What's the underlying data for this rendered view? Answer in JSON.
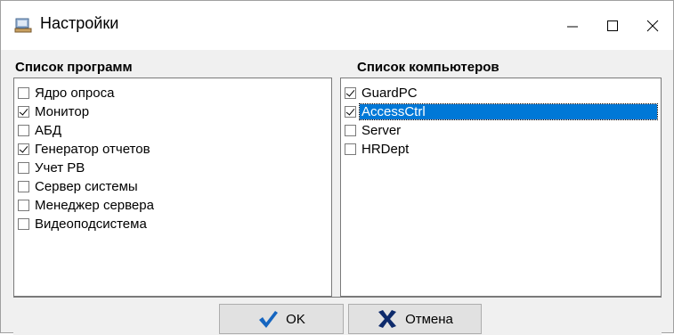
{
  "window": {
    "title": "Настройки",
    "icon": "settings-app-icon"
  },
  "programs": {
    "title": "Список программ",
    "items": [
      {
        "label": "Ядро опроса",
        "checked": false
      },
      {
        "label": "Монитор",
        "checked": true
      },
      {
        "label": "АБД",
        "checked": false
      },
      {
        "label": "Генератор отчетов",
        "checked": true
      },
      {
        "label": "Учет РВ",
        "checked": false
      },
      {
        "label": "Сервер системы",
        "checked": false
      },
      {
        "label": "Менеджер сервера",
        "checked": false
      },
      {
        "label": "Видеоподсистема",
        "checked": false
      }
    ]
  },
  "computers": {
    "title": "Список компьютеров",
    "items": [
      {
        "label": "GuardPC",
        "checked": true,
        "selected": false
      },
      {
        "label": "AccessCtrl",
        "checked": true,
        "selected": true
      },
      {
        "label": "Server",
        "checked": false,
        "selected": false
      },
      {
        "label": "HRDept",
        "checked": false,
        "selected": false
      }
    ]
  },
  "buttons": {
    "ok_label": "OK",
    "cancel_label": "Отмена",
    "ok_icon": "checkmark-icon",
    "cancel_icon": "x-mark-icon"
  },
  "colors": {
    "selection": "#0078d7",
    "ok_icon": "#1565c0",
    "cancel_icon": "#0d2a6b"
  }
}
